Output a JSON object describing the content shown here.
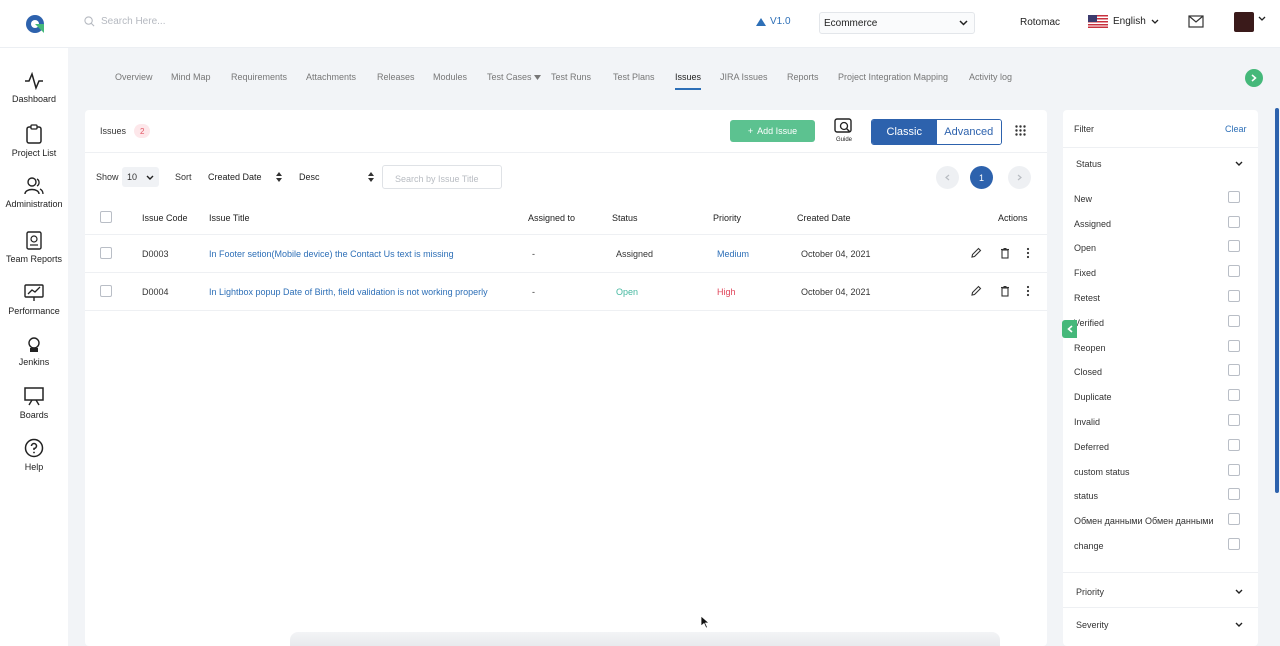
{
  "header": {
    "search_placeholder": "Search Here...",
    "version": "V1.0",
    "project": "Ecommerce",
    "organization": "Rotomac",
    "language": "English"
  },
  "sidebar": {
    "items": [
      {
        "label": "Dashboard",
        "icon": "pulse-icon"
      },
      {
        "label": "Project List",
        "icon": "clipboard-icon"
      },
      {
        "label": "Administration",
        "icon": "users-icon"
      },
      {
        "label": "Team Reports",
        "icon": "report-icon"
      },
      {
        "label": "Performance",
        "icon": "performance-icon"
      },
      {
        "label": "Jenkins",
        "icon": "jenkins-icon"
      },
      {
        "label": "Boards",
        "icon": "board-icon"
      },
      {
        "label": "Help",
        "icon": "help-icon"
      }
    ]
  },
  "tabs": [
    "Overview",
    "Mind Map",
    "Requirements",
    "Attachments",
    "Releases",
    "Modules",
    "Test Cases",
    "Test Runs",
    "Test Plans",
    "Issues",
    "JIRA Issues",
    "Reports",
    "Project Integration Mapping",
    "Activity log"
  ],
  "active_tab": "Issues",
  "issues": {
    "title": "Issues",
    "count": "2",
    "add_label": "Add Issue",
    "guide_label": "Guide",
    "view_classic": "Classic",
    "view_advanced": "Advanced",
    "show_label": "Show",
    "show_value": "10",
    "sort_label": "Sort",
    "sort_field": "Created Date",
    "sort_order": "Desc",
    "search_placeholder": "Search by Issue Title",
    "current_page": "1",
    "columns": [
      "Issue Code",
      "Issue Title",
      "Assigned to",
      "Status",
      "Priority",
      "Created Date",
      "Actions"
    ],
    "rows": [
      {
        "code": "D0003",
        "title": "In Footer setion(Mobile device) the Contact Us text is missing",
        "assigned": "-",
        "status": "Assigned",
        "priority": "Medium",
        "created": "October 04, 2021"
      },
      {
        "code": "D0004",
        "title": "In Lightbox popup Date of Birth, field validation is not working properly",
        "assigned": "-",
        "status": "Open",
        "priority": "High",
        "created": "October 04, 2021"
      }
    ]
  },
  "filter": {
    "title": "Filter",
    "clear": "Clear",
    "status_section": "Status",
    "status_options": [
      "New",
      "Assigned",
      "Open",
      "Fixed",
      "Retest",
      "Verified",
      "Reopen",
      "Closed",
      "Duplicate",
      "Invalid",
      "Deferred",
      "custom status",
      "status",
      "Обмен данными Обмен данными",
      "change"
    ],
    "priority_section": "Priority",
    "severity_section": "Severity"
  },
  "colors": {
    "primary": "#2d62ad",
    "accent_green": "#5cc290",
    "link": "#2d6fb7",
    "high": "#e0455a"
  }
}
